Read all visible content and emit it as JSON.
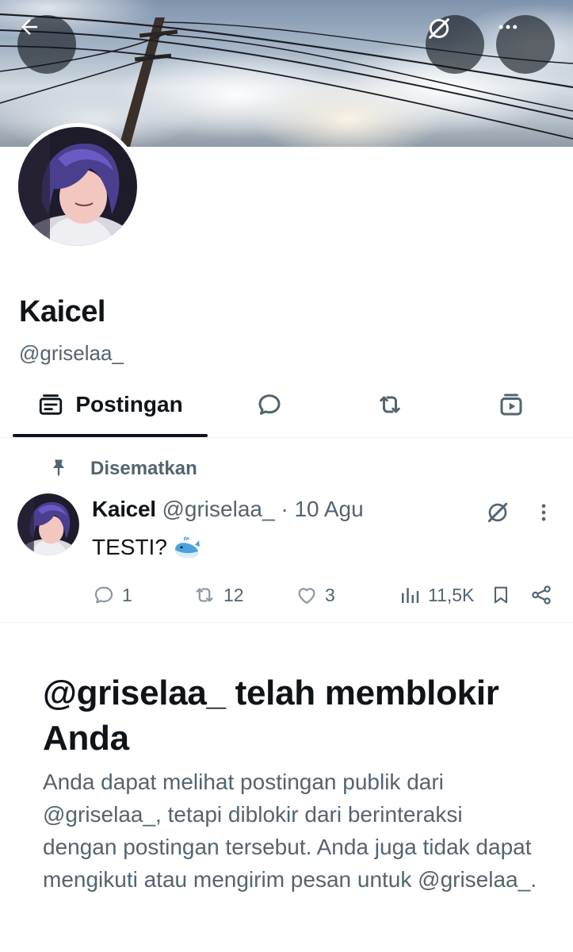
{
  "header": {
    "back_icon": "arrow-left-icon",
    "grok_icon": "grok-icon",
    "more_icon": "more-horizontal-icon"
  },
  "profile": {
    "name": "Kaicel",
    "handle": "@griselaa_"
  },
  "tabs": [
    {
      "label": "Postingan",
      "icon": "posts-icon",
      "active": true
    },
    {
      "label": "",
      "icon": "reply-icon",
      "active": false
    },
    {
      "label": "",
      "icon": "retweet-icon",
      "active": false
    },
    {
      "label": "",
      "icon": "media-icon",
      "active": false
    }
  ],
  "pinned_post": {
    "pinned_label": "Disematkan",
    "author_name": "Kaicel",
    "author_handle": "@griselaa_",
    "date": "10 Agu",
    "text": "TESTI?",
    "emoji": "whale",
    "stats": {
      "replies": "1",
      "retweets": "12",
      "likes": "3",
      "views": "11,5K"
    }
  },
  "blocked_notice": {
    "title": "@griselaa_ telah memblokir Anda",
    "body": "Anda dapat melihat postingan publik dari @griselaa_, tetapi diblokir dari berinteraksi dengan postingan tersebut. Anda juga tidak dapat mengikuti atau mengirim pesan untuk @griselaa_."
  },
  "colors": {
    "text_primary": "#0f1419",
    "text_secondary": "#536471",
    "divider": "#eff3f4"
  }
}
